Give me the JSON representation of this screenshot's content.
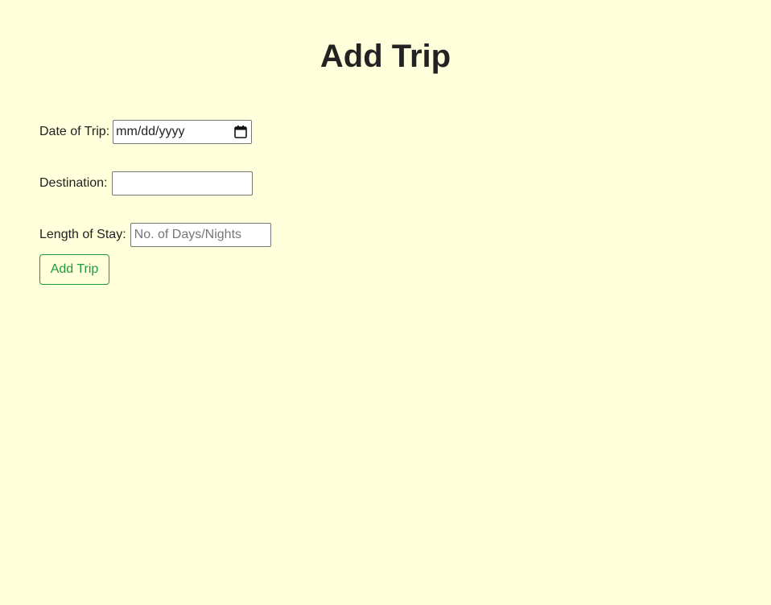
{
  "page": {
    "title": "Add Trip",
    "background": "#ffffdc",
    "accent": "#1e9a3c"
  },
  "form": {
    "date": {
      "label": "Date of Trip:",
      "value": "mm/dd/yyyy",
      "icon": "calendar-icon"
    },
    "destination": {
      "label": "Destination:",
      "value": "",
      "placeholder": ""
    },
    "length_of_stay": {
      "label": "Length of Stay:",
      "value": "",
      "placeholder": "No. of Days/Nights"
    },
    "submit_label": "Add Trip"
  }
}
